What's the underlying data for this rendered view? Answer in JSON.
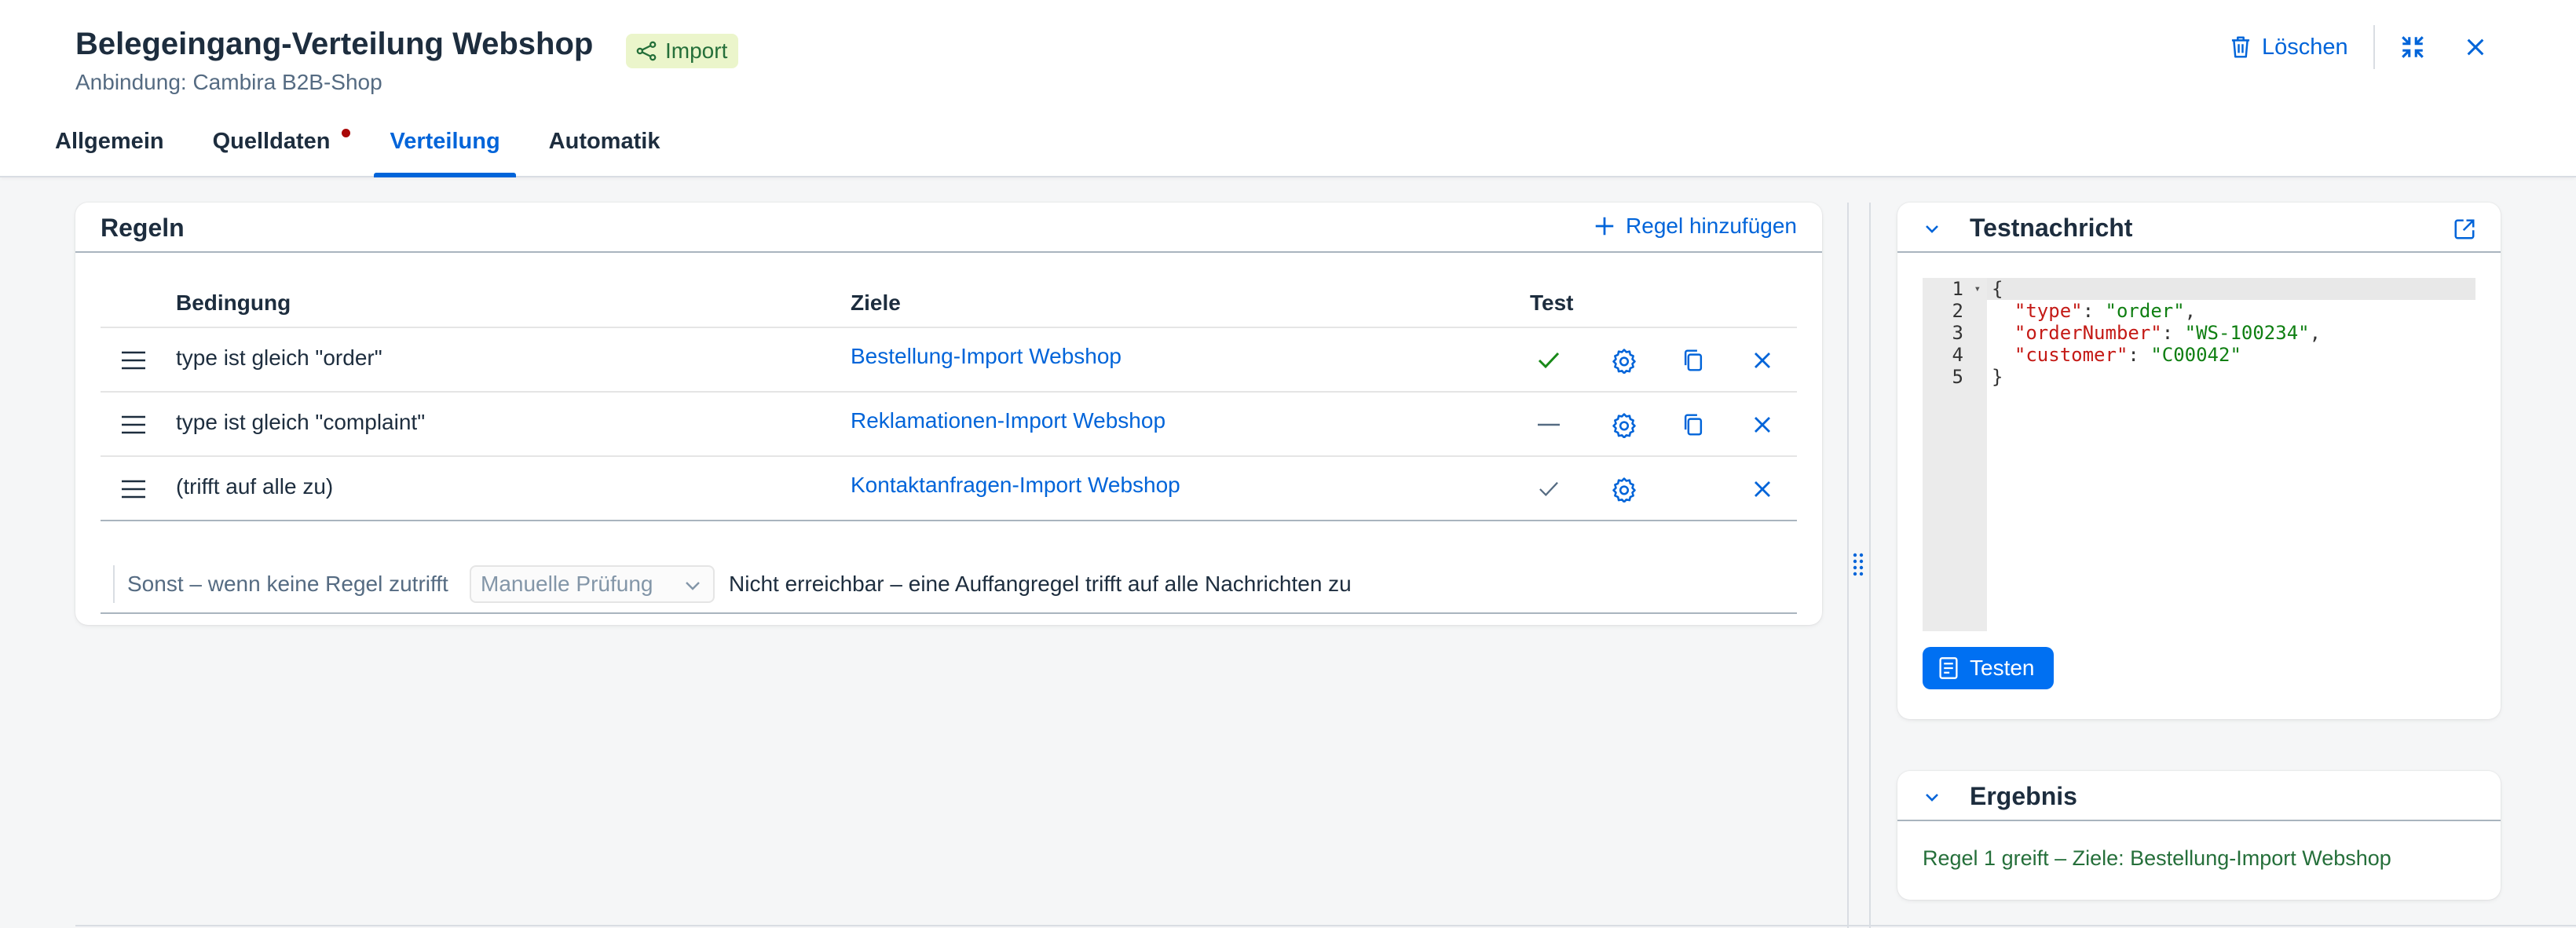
{
  "header": {
    "title": "Belegeingang-Verteilung Webshop",
    "badge": "Import",
    "subtitle": "Anbindung: Cambira B2B-Shop",
    "delete_label": "Löschen"
  },
  "tabs": [
    {
      "label": "Allgemein",
      "active": false
    },
    {
      "label": "Quelldaten",
      "active": false,
      "indicator": true
    },
    {
      "label": "Verteilung",
      "active": true
    },
    {
      "label": "Automatik",
      "active": false
    }
  ],
  "rules": {
    "title": "Regeln",
    "add_label": "Regel hinzufügen",
    "columns": {
      "condition": "Bedingung",
      "targets": "Ziele",
      "test": "Test"
    },
    "rows": [
      {
        "condition": "type ist gleich \"order\"",
        "target": "Bestellung-Import Webshop",
        "test": "match",
        "copyable": true
      },
      {
        "condition": "type ist gleich \"complaint\"",
        "target": "Reklamationen-Import Webshop",
        "test": "none",
        "copyable": true
      },
      {
        "condition": "(trifft auf alle zu)",
        "target": "Kontaktanfragen-Import Webshop",
        "test": "match-inactive",
        "copyable": false
      }
    ],
    "else": {
      "label": "Sonst – wenn keine Regel zutrifft",
      "select_value": "Manuelle Prüfung",
      "info": "Nicht erreichbar – eine Auffangregel trifft auf alle Nachrichten zu"
    }
  },
  "test_message": {
    "title": "Testnachricht",
    "lines": [
      "{",
      "  \"type\": \"order\",",
      "  \"orderNumber\": \"WS-100234\",",
      "  \"customer\": \"C00042\"",
      "}"
    ],
    "button_label": "Testen"
  },
  "result": {
    "title": "Ergebnis",
    "text": "Regel 1 greift – Ziele: Bestellung-Import Webshop"
  },
  "colors": {
    "accent": "#0064d9",
    "button": "#0070f2",
    "success": "#256f3a",
    "badge_bg": "#ebf5cb",
    "error_dot": "#aa0808"
  }
}
